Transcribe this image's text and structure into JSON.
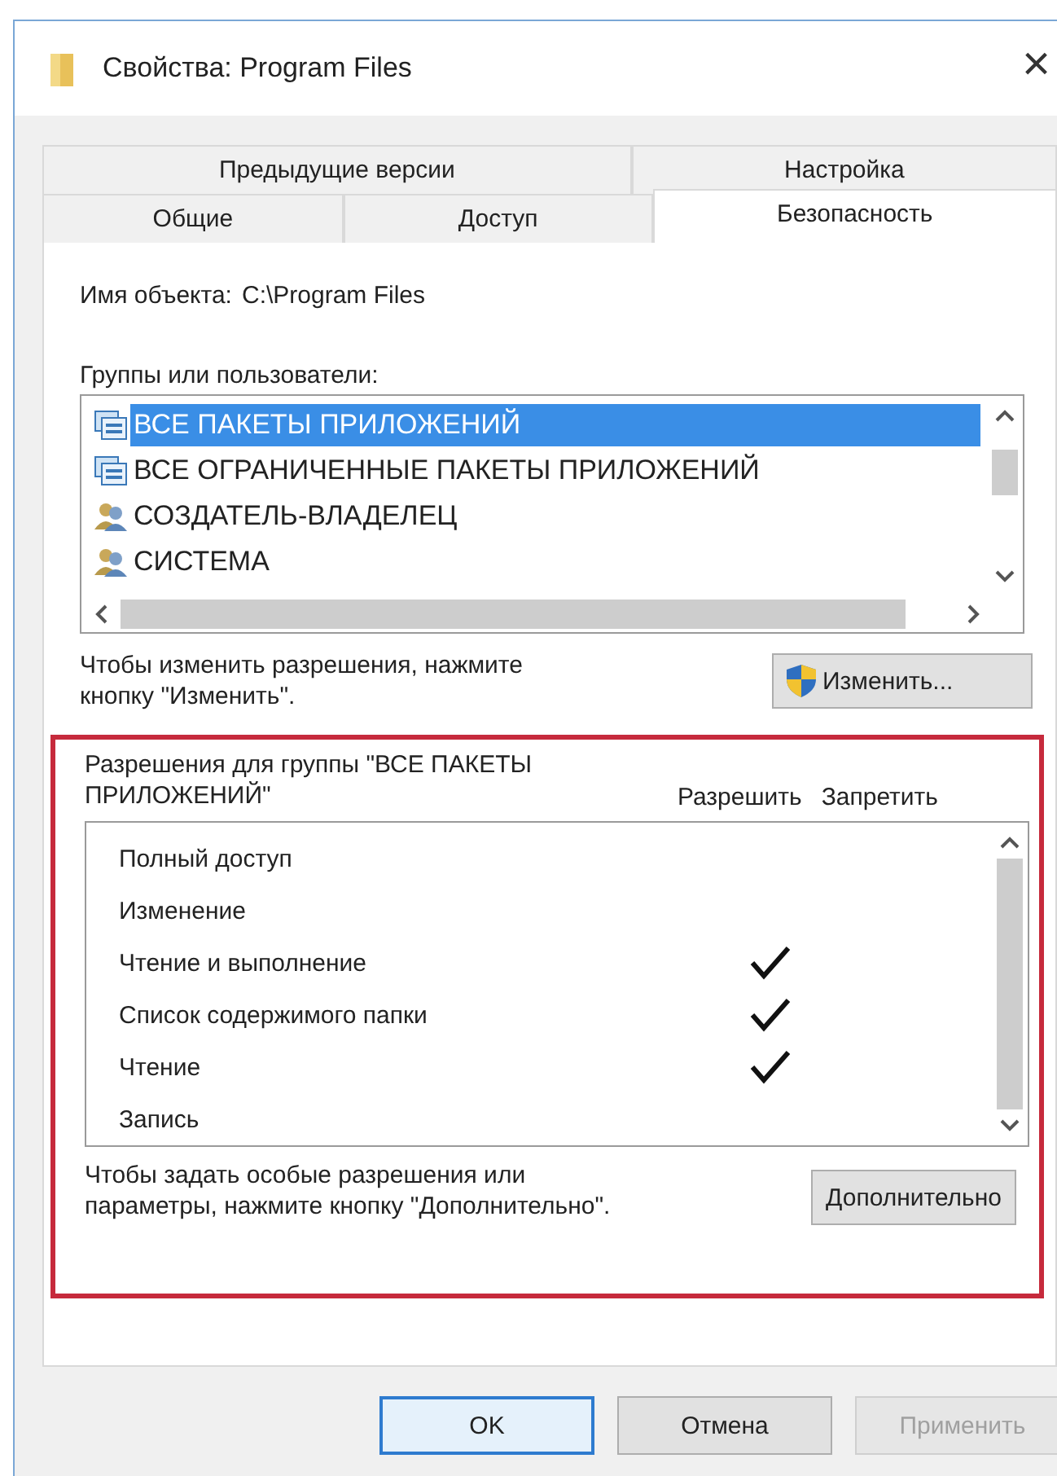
{
  "window": {
    "title": "Свойства: Program Files",
    "close": "×"
  },
  "tab_rows": [
    {
      "tabs": [
        {
          "label": "Предыдущие версии",
          "selected": false
        },
        {
          "label": "Настройка",
          "selected": false
        }
      ]
    },
    {
      "tabs": [
        {
          "label": "Общие",
          "selected": false
        },
        {
          "label": "Доступ",
          "selected": false
        },
        {
          "label": "Безопасность",
          "selected": true
        }
      ]
    }
  ],
  "object_name": {
    "label": "Имя объекта:",
    "value": "C:\\Program Files"
  },
  "groups": {
    "label": "Группы или пользователи:",
    "items": [
      {
        "name": "ВСЕ ПАКЕТЫ ПРИЛОЖЕНИЙ",
        "kind": "package",
        "selected": true
      },
      {
        "name": "ВСЕ ОГРАНИЧЕННЫЕ ПАКЕТЫ ПРИЛОЖЕНИЙ",
        "kind": "package",
        "selected": false
      },
      {
        "name": "СОЗДАТЕЛЬ-ВЛАДЕЛЕЦ",
        "kind": "users",
        "selected": false
      },
      {
        "name": "СИСТЕМА",
        "kind": "users",
        "selected": false
      }
    ]
  },
  "change_hint": "Чтобы изменить разрешения, нажмите кнопку \"Изменить\".",
  "change_button": "Изменить...",
  "permissions": {
    "highlighted": true,
    "label": "Разрешения для группы \"ВСЕ ПАКЕТЫ ПРИЛОЖЕНИЙ\"",
    "allow_header": "Разрешить",
    "deny_header": "Запретить",
    "rows": [
      {
        "name": "Полный доступ",
        "allow": false,
        "deny": false
      },
      {
        "name": "Изменение",
        "allow": false,
        "deny": false
      },
      {
        "name": "Чтение и выполнение",
        "allow": true,
        "deny": false
      },
      {
        "name": "Список содержимого папки",
        "allow": true,
        "deny": false
      },
      {
        "name": "Чтение",
        "allow": true,
        "deny": false
      },
      {
        "name": "Запись",
        "allow": false,
        "deny": false
      }
    ]
  },
  "advanced_hint": "Чтобы задать особые разрешения или параметры, нажмите кнопку \"Дополнительно\".",
  "advanced_button": "Дополнительно",
  "buttons": [
    {
      "label": "OK",
      "default": true,
      "disabled": false
    },
    {
      "label": "Отмена",
      "default": false,
      "disabled": false
    },
    {
      "label": "Применить",
      "default": false,
      "disabled": true
    }
  ]
}
